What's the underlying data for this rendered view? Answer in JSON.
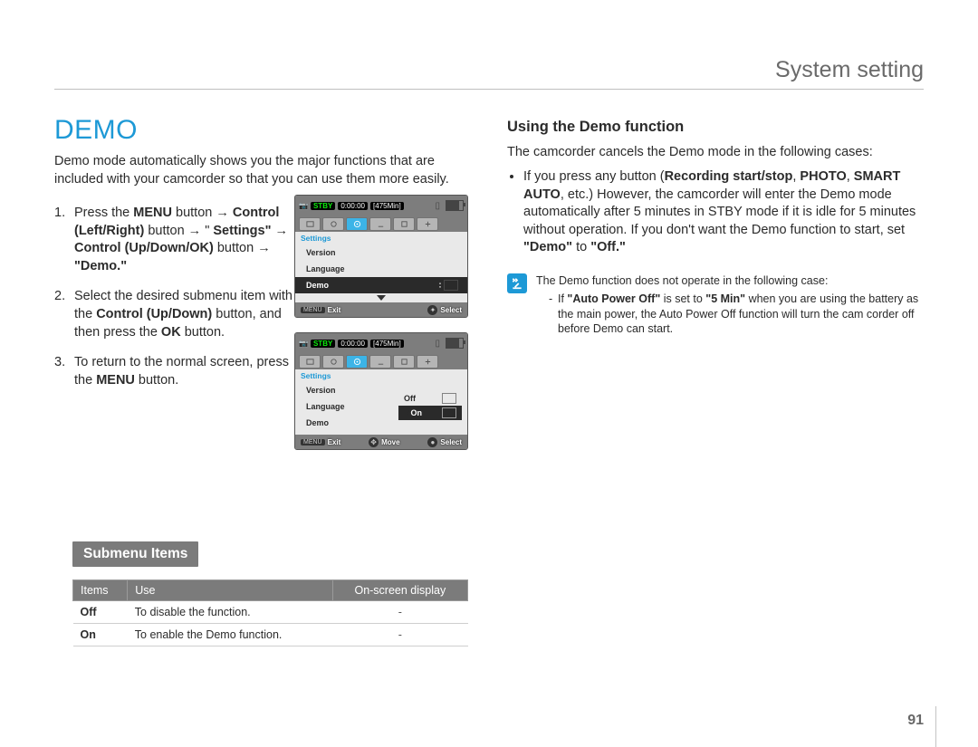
{
  "header": {
    "breadcrumb": "System setting"
  },
  "title": "DEMO",
  "intro": "Demo mode automatically shows you the major functions that are included with your camcorder so that you can use them more easily.",
  "steps": {
    "s1_a": "Press the ",
    "s1_b": "MENU",
    "s1_c": " button → ",
    "s1_d": "Control (Left/Right)",
    "s1_e": " button → \" ",
    "s1_f": "Settings\"",
    "s1_g": " → ",
    "s1_h": "Control (Up/Down/OK)",
    "s1_i": " button → ",
    "s1_j": "\"Demo.\"",
    "s2_a": "Select the desired submenu item with the ",
    "s2_b": "Control (Up/Down)",
    "s2_c": " button, and then press the ",
    "s2_d": "OK",
    "s2_e": " button.",
    "s3_a": "To return to the normal screen, press the ",
    "s3_b": "MENU",
    "s3_c": " button."
  },
  "submenu": {
    "badge": "Submenu Items",
    "headers": [
      "Items",
      "Use",
      "On-screen display"
    ],
    "rows": [
      {
        "item": "Off",
        "use": "To disable the function.",
        "osd": "-"
      },
      {
        "item": "On",
        "use": "To enable the Demo function.",
        "osd": "-"
      }
    ]
  },
  "right": {
    "heading": "Using the Demo function",
    "intro": "The camcorder cancels the Demo mode in the following cases:",
    "bullet_a": "If you press any button (",
    "bullet_b": "Recording start/stop",
    "bullet_c": ", ",
    "bullet_d": "PHOTO",
    "bullet_e": ", ",
    "bullet_f": "SMART AUTO",
    "bullet_g": ", etc.) However, the camcorder will enter the Demo mode automatically after 5 minutes in STBY mode if it is idle for 5 minutes without operation. If you don't want the Demo function to start, set ",
    "bullet_h": "\"Demo\"",
    "bullet_i": " to ",
    "bullet_j": "\"Off.\""
  },
  "note": {
    "lead": "The Demo function does not operate in the following case:",
    "sub_a": "If ",
    "sub_b": "\"Auto Power Off\"",
    "sub_c": " is set to ",
    "sub_d": "\"5 Min\"",
    "sub_e": " when you are using the battery as the main power, the Auto Power Off function will turn the cam corder off before Demo can start."
  },
  "lcd": {
    "stby": "STBY",
    "timecode": "0:00:00",
    "remain": "[475Min]",
    "crumb": "Settings",
    "menu_items": [
      "Version",
      "Language",
      "Demo"
    ],
    "options": [
      "Off",
      "On"
    ],
    "exit_key": "MENU",
    "exit_label": "Exit",
    "move_label": "Move",
    "select_label": "Select"
  },
  "page_number": "91"
}
